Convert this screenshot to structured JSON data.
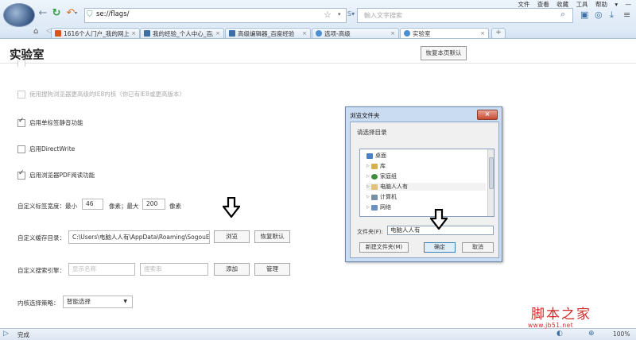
{
  "browser": {
    "address": "se://flags/",
    "search_placeholder": "輸入文字搜索",
    "menu": [
      "文件",
      "查看",
      "收藏",
      "工具",
      "帮助"
    ],
    "tabs": [
      {
        "label": "1616个人门户_我的网上",
        "color": "#d9541e"
      },
      {
        "label": "我的经验_个人中心_百度",
        "color": "#3a6ea5"
      },
      {
        "label": "高级编辑器_百度经验",
        "color": "#3a6ea5"
      },
      {
        "label": "选项-高级",
        "color": "#4b8fd2"
      },
      {
        "label": "实验室",
        "color": "#4b8fd2"
      }
    ]
  },
  "page": {
    "title": "实验室",
    "reset_all": "恢复本页默认",
    "options": [
      {
        "label": "使用搜狗浏览器更高级的IE8内核（你已有IE8或更高版本）",
        "checked": false,
        "disabled": true
      },
      {
        "label": "启用单标签静音功能",
        "checked": true,
        "disabled": false
      },
      {
        "label": "启用DirectWrite",
        "checked": false,
        "disabled": false
      },
      {
        "label": "启用浏览器PDF阅读功能",
        "checked": true,
        "disabled": false
      }
    ],
    "tab_width": {
      "label": "自定义标签宽度：",
      "min_label": "最小",
      "min_value": "46",
      "unit1": "像素；最大",
      "max_value": "200",
      "unit2": "像素"
    },
    "cache_dir": {
      "label": "自定义缓存目录：",
      "value": "C:\\Users\\电脑人人有\\AppData\\Roaming\\SogouEx",
      "browse": "浏览",
      "reset": "恢复默认"
    },
    "search_engine": {
      "label": "自定义搜索引擎：",
      "name_placeholder": "显示名称",
      "url_placeholder": "搜索串",
      "add": "添加",
      "manage": "管理"
    },
    "kernel": {
      "label": "内核选择策略：",
      "value": "智能选择"
    }
  },
  "dialog": {
    "title": "浏览文件夹",
    "prompt": "请选择目录",
    "tree": [
      {
        "label": "桌面",
        "indent": 0,
        "color": "#4a7fc1"
      },
      {
        "label": "库",
        "indent": 1,
        "color": "#d6b14a"
      },
      {
        "label": "家庭组",
        "indent": 1,
        "color": "#3c8d3c"
      },
      {
        "label": "电脑人人有",
        "indent": 1,
        "color": "#e0c27a",
        "selected": true
      },
      {
        "label": "计算机",
        "indent": 1,
        "color": "#7a8ea8"
      },
      {
        "label": "网络",
        "indent": 1,
        "color": "#6b91c2"
      }
    ],
    "folder_label": "文件夹(F):",
    "folder_value": "电脑人人有",
    "new_folder": "新建文件夹(M)",
    "ok": "确定",
    "cancel": "取消"
  },
  "status": {
    "text": "完成",
    "zoom": "100%"
  },
  "watermark": {
    "title": "脚本之家",
    "url": "www.jb51.net"
  }
}
